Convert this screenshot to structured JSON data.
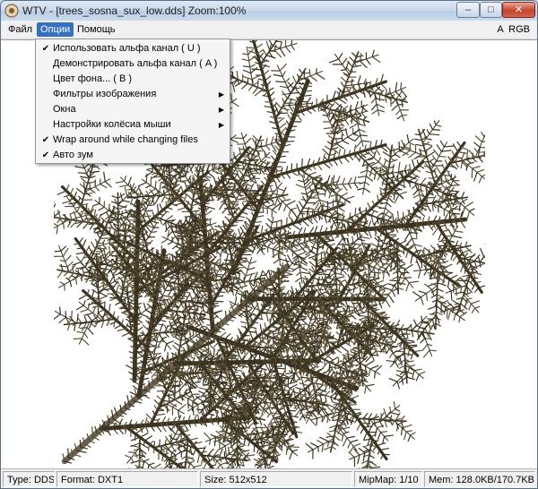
{
  "window": {
    "title": "WTV - [trees_sosna_sux_low.dds] Zoom:100%",
    "controls": {
      "minimize": "–",
      "maximize": "□",
      "close": "✕"
    }
  },
  "menubar": {
    "items": [
      "Файл",
      "Опции",
      "Помощь"
    ],
    "channel_indicator": "A  RGB"
  },
  "options_menu": [
    {
      "label": "Использовать альфа канал ( U )",
      "checked": true,
      "submenu": false
    },
    {
      "label": "Демонстрировать альфа канал ( A )",
      "checked": false,
      "submenu": false
    },
    {
      "label": "Цвет фона... ( B )",
      "checked": false,
      "submenu": false
    },
    {
      "label": "Фильтры изображения",
      "checked": false,
      "submenu": true
    },
    {
      "label": "Окна",
      "checked": false,
      "submenu": true
    },
    {
      "label": "Настройки колёсиа мыши",
      "checked": false,
      "submenu": true
    },
    {
      "label": "Wrap around while changing files",
      "checked": true,
      "submenu": false
    },
    {
      "label": "Авто зум",
      "checked": true,
      "submenu": false
    }
  ],
  "statusbar": {
    "type": "Type: DDS",
    "format": "Format: DXT1",
    "size": "Size: 512x512",
    "mipmap": "MipMap: 1/10",
    "memory": "Mem: 128.0KB/170.7KB"
  },
  "image": {
    "description_icon": "pine-branch-texture",
    "colors": {
      "needles": "#3b3320",
      "needles_light": "#5a5034",
      "bark": "#6b6250",
      "background": "#ffffff"
    }
  },
  "glyphs": {
    "check": "✔",
    "submenu_arrow": "▶"
  }
}
